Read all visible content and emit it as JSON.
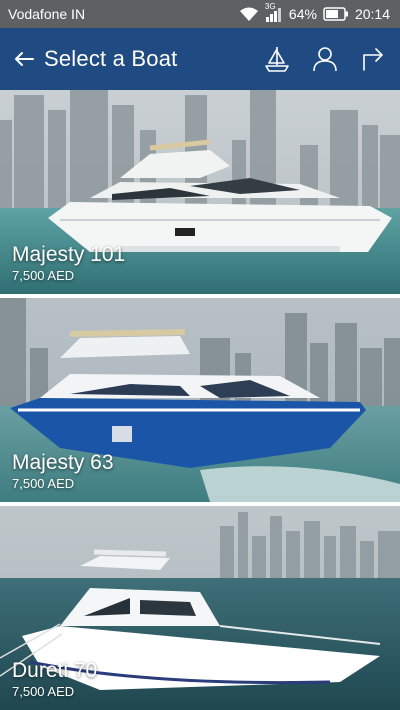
{
  "status_bar": {
    "carrier": "Vodafone IN",
    "network": "3G",
    "battery": "64%",
    "time": "20:14"
  },
  "app_bar": {
    "title": "Select a Boat",
    "back_icon": "arrow-left-icon",
    "actions": [
      {
        "name": "boat-icon"
      },
      {
        "name": "user-icon"
      },
      {
        "name": "share-icon"
      }
    ]
  },
  "boats": [
    {
      "name": "Majesty 101",
      "price": "7,500 AED"
    },
    {
      "name": "Majesty 63",
      "price": "7,500 AED"
    },
    {
      "name": "Dureti 70",
      "price": "7,500 AED"
    }
  ],
  "colors": {
    "app_bar": "#1f4b82",
    "status_bar": "#5f6062"
  }
}
